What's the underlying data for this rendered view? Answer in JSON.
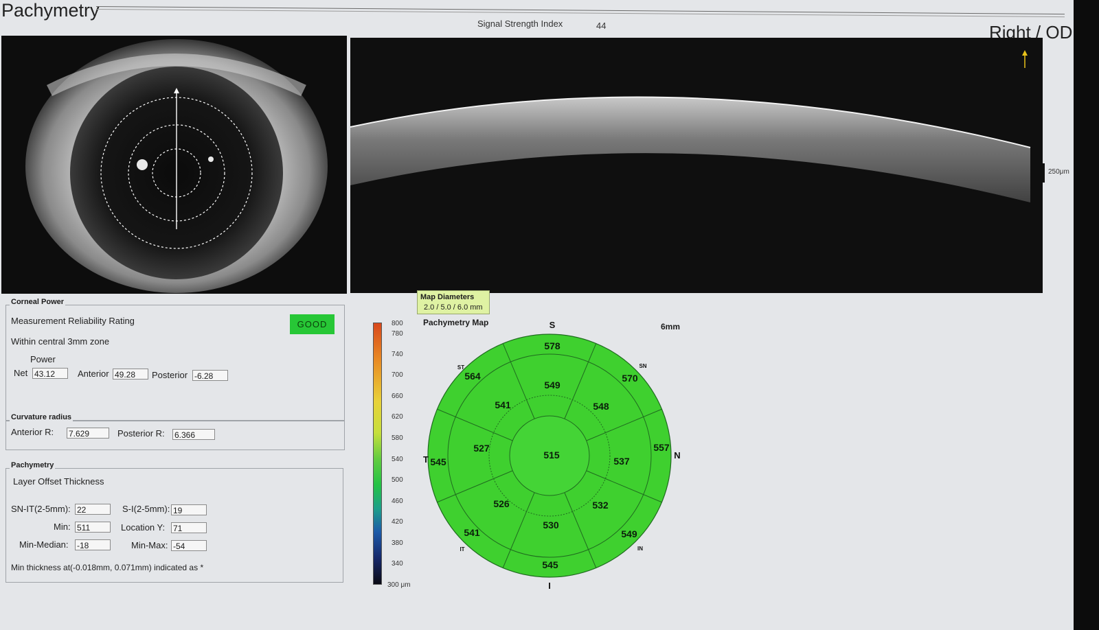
{
  "header": {
    "title": "Pachymetry",
    "signal_strength_label": "Signal Strength Index",
    "signal_strength_value": "44",
    "eye": "Right / OD"
  },
  "oct": {
    "scale_label": "250μm"
  },
  "corneal_power": {
    "title": "Corneal Power",
    "reliability_label": "Measurement Reliability Rating",
    "reliability_value": "GOOD",
    "zone_label": "Within central 3mm zone",
    "power_label": "Power",
    "net_label": "Net",
    "net_value": "43.12",
    "anterior_label": "Anterior",
    "anterior_value": "49.28",
    "posterior_label": "Posterior",
    "posterior_value": "-6.28"
  },
  "curvature": {
    "title": "Curvature radius",
    "anterior_label": "Anterior R:",
    "anterior_value": "7.629",
    "posterior_label": "Posterior R:",
    "posterior_value": "6.366"
  },
  "pachymetry": {
    "title": "Pachymetry",
    "header": "Layer  Offset  Thickness",
    "snit_label": "SN-IT(2-5mm):",
    "snit_value": "22",
    "si_label": "S-I(2-5mm):",
    "si_value": "19",
    "min_label": "Min:",
    "min_value": "511",
    "locy_label": "Location Y:",
    "locy_value": "71",
    "minmed_label": "Min-Median:",
    "minmed_value": "-18",
    "minmax_label": "Min-Max:",
    "minmax_value": "-54",
    "note": "Min thickness at(-0.018mm, 0.071mm) indicated as *"
  },
  "map": {
    "diameters_label": "Map Diameters",
    "diameters_value": "2.0 / 5.0 / 6.0 mm",
    "title": "Pachymetry Map",
    "size": "6mm",
    "colorbar_ticks": [
      "800",
      "780",
      "740",
      "700",
      "660",
      "620",
      "580",
      "540",
      "500",
      "460",
      "420",
      "380",
      "340",
      "300 μm"
    ],
    "directions": {
      "S": "S",
      "N": "N",
      "T": "T",
      "I": "I"
    },
    "sector_labels": {
      "ST": "ST",
      "SN": "SN",
      "IT": "IT",
      "IN": "IN"
    },
    "center": "515",
    "ring2": {
      "S": "549",
      "SN": "548",
      "N": "537",
      "IN": "532",
      "I": "530",
      "IT": "526",
      "T": "527",
      "ST": "541"
    },
    "ring3": {
      "S": "578",
      "SN": "570",
      "N": "557",
      "IN": "549",
      "I": "545",
      "IT": "541",
      "T": "545",
      "ST": "564"
    },
    "colors": {
      "map_green": "#3fd02f",
      "ring_line": "#1f6b1f"
    }
  }
}
